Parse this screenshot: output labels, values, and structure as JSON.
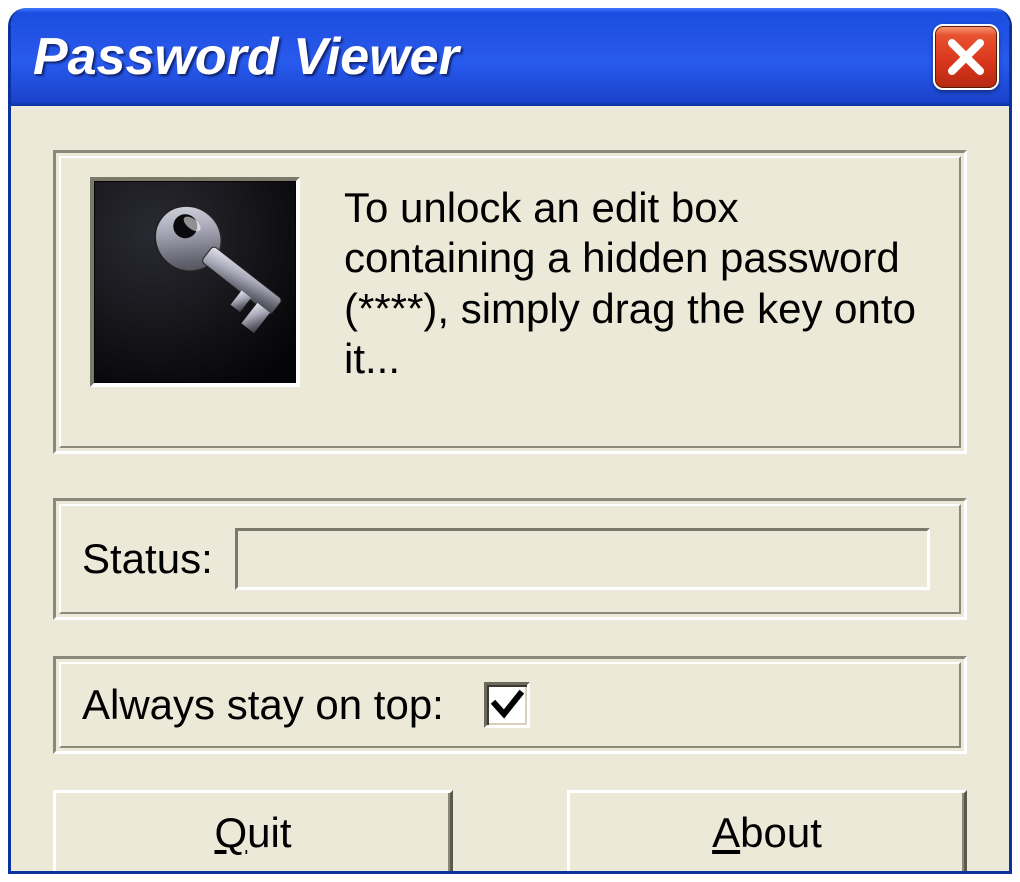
{
  "window": {
    "title": "Password Viewer"
  },
  "instructions": {
    "text": "To unlock an edit box containing a hidden password (****), simply drag the key onto it...",
    "icon_name": "key-icon"
  },
  "status": {
    "label": "Status:",
    "value": ""
  },
  "always_on_top": {
    "label": "Always stay on top:",
    "checked": true
  },
  "buttons": {
    "quit": {
      "prefix": "",
      "accel": "Q",
      "suffix": "uit"
    },
    "about": {
      "prefix": "",
      "accel": "A",
      "suffix": "bout"
    }
  },
  "colors": {
    "titlebar_start": "#3f78ff",
    "titlebar_end": "#0a33a0",
    "face": "#ece9d8",
    "close_red": "#d8351a"
  }
}
